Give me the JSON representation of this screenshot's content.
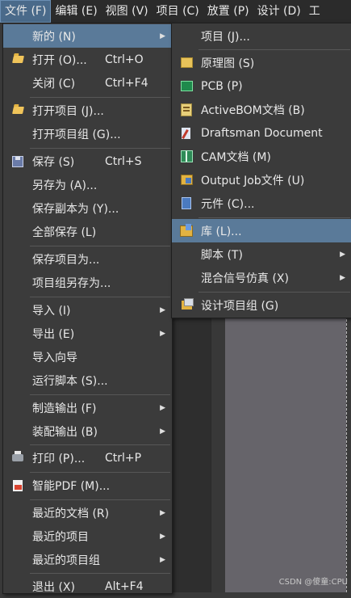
{
  "menubar": {
    "items": [
      "文件 (F)",
      "编辑 (E)",
      "视图 (V)",
      "项目 (C)",
      "放置 (P)",
      "设计 (D)",
      "工"
    ]
  },
  "file_menu": {
    "items": [
      {
        "label": "新的 (N)",
        "shortcut": "",
        "submenu": true,
        "icon": ""
      },
      {
        "label": "打开 (O)...",
        "shortcut": "Ctrl+O",
        "submenu": false,
        "icon": "open-folder-icon"
      },
      {
        "label": "关闭 (C)",
        "shortcut": "Ctrl+F4",
        "submenu": false,
        "icon": ""
      },
      {
        "label": "打开项目 (J)...",
        "shortcut": "",
        "submenu": false,
        "icon": "open-project-icon"
      },
      {
        "label": "打开项目组 (G)...",
        "shortcut": "",
        "submenu": false,
        "icon": ""
      },
      {
        "label": "保存 (S)",
        "shortcut": "Ctrl+S",
        "submenu": false,
        "icon": "save-icon"
      },
      {
        "label": "另存为 (A)...",
        "shortcut": "",
        "submenu": false,
        "icon": ""
      },
      {
        "label": "保存副本为 (Y)...",
        "shortcut": "",
        "submenu": false,
        "icon": ""
      },
      {
        "label": "全部保存 (L)",
        "shortcut": "",
        "submenu": false,
        "icon": ""
      },
      {
        "label": "保存项目为...",
        "shortcut": "",
        "submenu": false,
        "icon": ""
      },
      {
        "label": "项目组另存为...",
        "shortcut": "",
        "submenu": false,
        "icon": ""
      },
      {
        "label": "导入 (I)",
        "shortcut": "",
        "submenu": true,
        "icon": ""
      },
      {
        "label": "导出 (E)",
        "shortcut": "",
        "submenu": true,
        "icon": ""
      },
      {
        "label": "导入向导",
        "shortcut": "",
        "submenu": false,
        "icon": ""
      },
      {
        "label": "运行脚本 (S)...",
        "shortcut": "",
        "submenu": false,
        "icon": ""
      },
      {
        "label": "制造输出 (F)",
        "shortcut": "",
        "submenu": true,
        "icon": ""
      },
      {
        "label": "装配输出 (B)",
        "shortcut": "",
        "submenu": true,
        "icon": ""
      },
      {
        "label": "打印 (P)...",
        "shortcut": "Ctrl+P",
        "submenu": false,
        "icon": "printer-icon"
      },
      {
        "label": "智能PDF (M)...",
        "shortcut": "",
        "submenu": false,
        "icon": "smart-pdf-icon"
      },
      {
        "label": "最近的文档 (R)",
        "shortcut": "",
        "submenu": true,
        "icon": ""
      },
      {
        "label": "最近的项目",
        "shortcut": "",
        "submenu": true,
        "icon": ""
      },
      {
        "label": "最近的项目组",
        "shortcut": "",
        "submenu": true,
        "icon": ""
      },
      {
        "label": "退出 (X)",
        "shortcut": "Alt+F4",
        "submenu": false,
        "icon": ""
      }
    ]
  },
  "new_menu": {
    "items": [
      {
        "label": "项目 (J)...",
        "submenu": false,
        "icon": ""
      },
      {
        "label": "原理图 (S)",
        "submenu": false,
        "icon": "schematic-icon"
      },
      {
        "label": "PCB (P)",
        "submenu": false,
        "icon": "pcb-icon"
      },
      {
        "label": "ActiveBOM文档 (B)",
        "submenu": false,
        "icon": "activebom-icon"
      },
      {
        "label": "Draftsman Document",
        "submenu": false,
        "icon": "draftsman-icon"
      },
      {
        "label": "CAM文档 (M)",
        "submenu": false,
        "icon": "cam-icon"
      },
      {
        "label": "Output Job文件 (U)",
        "submenu": false,
        "icon": "output-job-icon"
      },
      {
        "label": "元件 (C)...",
        "submenu": false,
        "icon": "component-icon"
      },
      {
        "label": "库 (L)...",
        "submenu": false,
        "icon": "library-icon"
      },
      {
        "label": "脚本 (T)",
        "submenu": true,
        "icon": ""
      },
      {
        "label": "混合信号仿真 (X)",
        "submenu": true,
        "icon": ""
      },
      {
        "label": "设计项目组 (G)",
        "submenu": false,
        "icon": "design-project-group-icon"
      }
    ]
  },
  "watermark": "CSDN @傻童:CPU"
}
